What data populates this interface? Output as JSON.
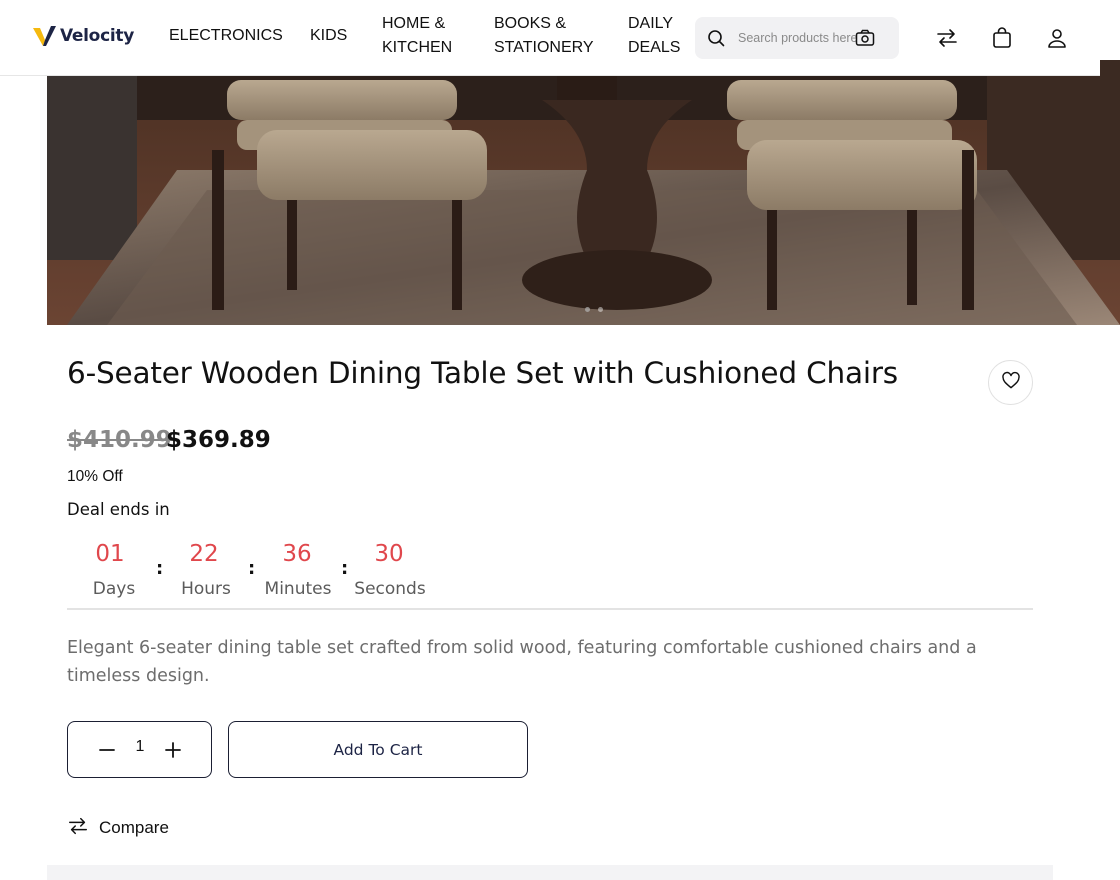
{
  "brand": {
    "name": "Velocity"
  },
  "nav": {
    "items": [
      {
        "label": "ELECTRONICS"
      },
      {
        "label": "KIDS"
      },
      {
        "label": "HOME &\nKITCHEN"
      },
      {
        "label": "BOOKS &\nSTATIONERY"
      },
      {
        "label": "DAILY\nDEALS"
      }
    ]
  },
  "search": {
    "placeholder": "Search products here"
  },
  "header_icons": [
    "compare-arrows-icon",
    "shopping-bag-icon",
    "user-icon"
  ],
  "product": {
    "title": "6-Seater Wooden Dining Table Set with Cushioned Chairs",
    "old_price": "$410.99",
    "price": "$369.89",
    "discount": "10% Off",
    "deal_label": "Deal ends in",
    "countdown": {
      "days": "01",
      "days_label": "Days",
      "hours": "22",
      "hours_label": "Hours",
      "minutes": "36",
      "minutes_label": "Minutes",
      "seconds": "30",
      "seconds_label": "Seconds",
      "separator": ":"
    },
    "description": "Elegant 6-seater dining table set crafted from solid wood, featuring comfortable cushioned chairs and a timeless design.",
    "quantity": "1",
    "add_to_cart": "Add To Cart",
    "compare": "Compare"
  },
  "gallery": {
    "slides": 2,
    "active_slide": 1
  },
  "colors": {
    "countdown": "#e0474c",
    "brand_navy": "#1d2445",
    "logo_yellow": "#f5b90f"
  }
}
